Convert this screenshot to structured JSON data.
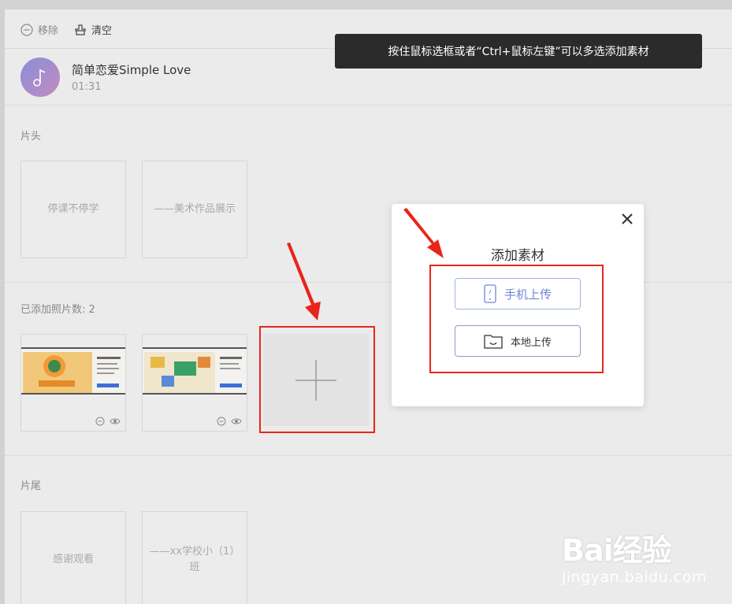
{
  "toolbar": {
    "remove_label": "移除",
    "clear_label": "清空"
  },
  "tooltip": "按住鼠标选框或者“Ctrl+鼠标左键”可以多选添加素材",
  "music": {
    "title": "简单恋爱Simple Love",
    "duration": "01:31"
  },
  "opening": {
    "label": "片头",
    "cards": [
      "停课不停学",
      "——美术作品展示"
    ]
  },
  "photos": {
    "label": "已添加照片数: 2"
  },
  "ending": {
    "label": "片尾",
    "cards": [
      "感谢观看",
      "——xx学校小（1）班"
    ]
  },
  "modal": {
    "title": "添加素材",
    "phone_upload": "手机上传",
    "local_upload": "本地上传"
  },
  "watermark": {
    "brand": "Bai经验",
    "url": "jingyan.baidu.com"
  },
  "colors": {
    "annotation_red": "#e8251b",
    "tooltip_bg": "#2b2b2b",
    "button_blue": "#6f86d6"
  }
}
